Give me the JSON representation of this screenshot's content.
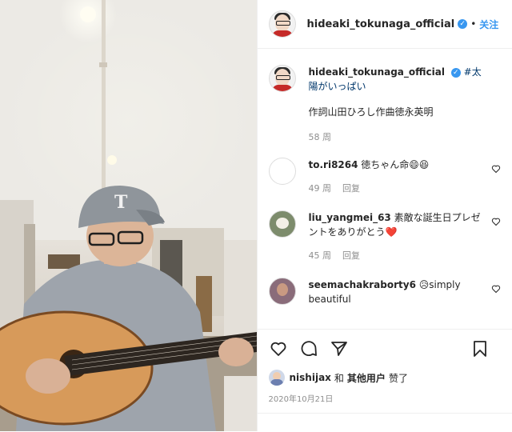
{
  "header": {
    "username": "hideaki_tokunaga_official",
    "verified_icon": "verified-badge-icon",
    "separator": "•",
    "follow_label": "关注"
  },
  "caption": {
    "username": "hideaki_tokunaga_official",
    "hashtag": "#太陽がいっぱい",
    "text": "作詞山田ひろし作曲徳永英明",
    "time": "58 周"
  },
  "comments": [
    {
      "username": "to.ri8264",
      "text": "徳ちゃん命😄😆",
      "time": "49 周",
      "reply": "回复"
    },
    {
      "username": "liu_yangmei_63",
      "text": "素敵な誕生日プレゼントをありがとう❤️",
      "time": "45 周",
      "reply": "回复"
    },
    {
      "username": "seemachakraborty6",
      "text": "😥simply beautiful"
    }
  ],
  "actions": {
    "like_icon": "heart-icon",
    "comment_icon": "comment-bubble-icon",
    "share_icon": "paper-plane-icon",
    "save_icon": "bookmark-icon"
  },
  "likes": {
    "user": "nishijax",
    "conj": "和",
    "others": "其他用户",
    "suffix": "赞了"
  },
  "date": "2020年10月21日",
  "colors": {
    "link": "#3897f0",
    "hashtag": "#00376b",
    "muted": "#8e8e8e",
    "heart": "#ed4956"
  }
}
